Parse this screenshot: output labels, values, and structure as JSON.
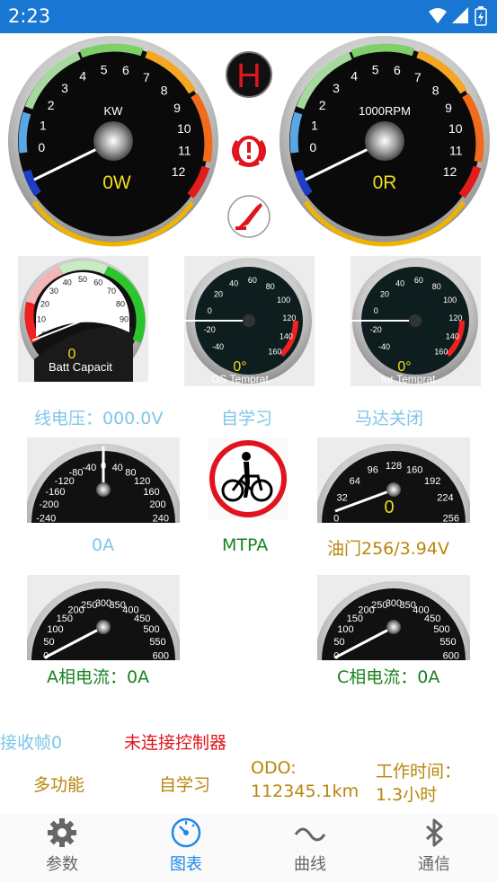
{
  "status_bar": {
    "time": "2:23"
  },
  "gauges": {
    "power": {
      "unit": "KW",
      "value_text": "0W",
      "ticks": [
        "0",
        "1",
        "2",
        "3",
        "4",
        "5",
        "6",
        "7",
        "8",
        "9",
        "10",
        "11",
        "12"
      ]
    },
    "rpm": {
      "unit": "1000RPM",
      "value_text": "0R",
      "ticks": [
        "0",
        "1",
        "2",
        "3",
        "4",
        "5",
        "6",
        "7",
        "8",
        "9",
        "10",
        "11",
        "12"
      ]
    },
    "battery": {
      "value_text": "0",
      "caption": "Batt Capacit",
      "ticks": [
        "0",
        "10",
        "20",
        "30",
        "40",
        "50",
        "60",
        "70",
        "80",
        "90",
        "100"
      ]
    },
    "controller_temp": {
      "value_text": "0°",
      "caption": "OS Temprat",
      "ticks": [
        "-40",
        "-20",
        "0",
        "20",
        "40",
        "60",
        "80",
        "100",
        "120",
        "140",
        "160"
      ]
    },
    "motor_temp": {
      "value_text": "0°",
      "caption": "tor Temprat",
      "ticks": [
        "-40",
        "-20",
        "0",
        "20",
        "40",
        "60",
        "80",
        "100",
        "120",
        "140",
        "160"
      ]
    },
    "current": {
      "ticks": [
        "-240",
        "-200",
        "-160",
        "-120",
        "-80",
        "-40",
        "0",
        "40",
        "80",
        "120",
        "160",
        "200",
        "240"
      ]
    },
    "throttle": {
      "value_text": "0",
      "ticks": [
        "0",
        "32",
        "64",
        "96",
        "128",
        "160",
        "192",
        "224",
        "256"
      ]
    },
    "phase_a": {
      "ticks": [
        "0",
        "50",
        "100",
        "150",
        "200",
        "250",
        "300",
        "350",
        "400",
        "450",
        "500",
        "550",
        "600"
      ]
    },
    "phase_c": {
      "ticks": [
        "0",
        "50",
        "100",
        "150",
        "200",
        "250",
        "300",
        "350",
        "400",
        "450",
        "500",
        "550",
        "600"
      ]
    }
  },
  "indicators": {
    "h_letter": "H",
    "h_color": "#e0141e",
    "warning_color": "#e0141e"
  },
  "labels": {
    "line_voltage": "线电压：000.0V",
    "self_learn_status": "自学习",
    "motor_status": "马达关闭",
    "current_value": "0A",
    "mode": "MTPA",
    "throttle": "油门256/3.94V",
    "phase_a_current": "A相电流：0A",
    "phase_c_current": "C相电流：0A",
    "frames_received": "接收帧0",
    "connection_status": "未连接控制器",
    "multi_function_button": "多功能",
    "self_learn_button": "自学习",
    "odo_label": "ODO:",
    "odo_value": "112345.1km",
    "work_time_label": "工作时间：",
    "work_time_value": "1.3小时"
  },
  "nav": {
    "items": [
      {
        "label": "参数",
        "icon": "gear-icon"
      },
      {
        "label": "图表",
        "icon": "gauge-icon",
        "active": true
      },
      {
        "label": "曲线",
        "icon": "wave-icon"
      },
      {
        "label": "通信",
        "icon": "bluetooth-icon"
      }
    ],
    "active_color": "#1e88e5"
  }
}
